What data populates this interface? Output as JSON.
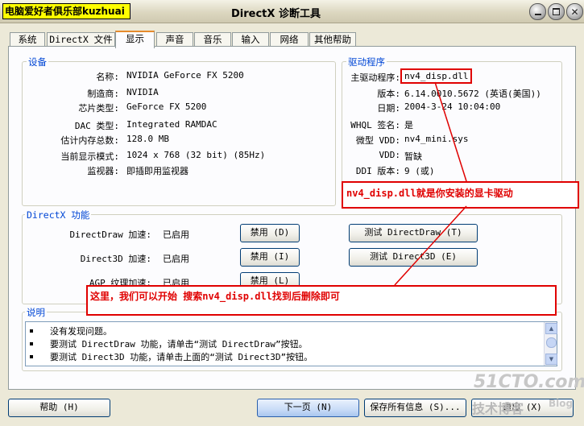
{
  "title_bar": {
    "brand": "电脑爱好者俱乐部kuzhuai",
    "title": "DirectX 诊断工具",
    "buttons": [
      "minimize-icon",
      "maximize-icon",
      "close-icon"
    ]
  },
  "tabs": [
    {
      "label": "系统"
    },
    {
      "label": "DirectX 文件"
    },
    {
      "label": "显示",
      "active": true
    },
    {
      "label": "声音"
    },
    {
      "label": "音乐"
    },
    {
      "label": "输入"
    },
    {
      "label": "网络"
    },
    {
      "label": "其他帮助"
    }
  ],
  "device": {
    "heading": "设备",
    "rows": [
      {
        "label": "名称:",
        "value": "NVIDIA GeForce FX 5200"
      },
      {
        "label": "制造商:",
        "value": "NVIDIA"
      },
      {
        "label": "芯片类型:",
        "value": "GeForce FX 5200"
      },
      {
        "label": "DAC 类型:",
        "value": "Integrated RAMDAC"
      },
      {
        "label": "估计内存总数:",
        "value": "128.0 MB"
      },
      {
        "label": "当前显示模式:",
        "value": "1024 x 768 (32 bit) (85Hz)"
      },
      {
        "label": "监视器:",
        "value": "即插即用监视器"
      }
    ]
  },
  "driver": {
    "heading": "驱动程序",
    "rows": [
      {
        "label": "主驱动程序:",
        "value": "nv4_disp.dll"
      },
      {
        "label": "版本:",
        "value": "6.14.0010.5672 (英语(美国))"
      },
      {
        "label": "日期:",
        "value": "2004-3-24 10:04:00"
      },
      {
        "label": "WHQL 签名:",
        "value": "是"
      },
      {
        "label": "微型 VDD:",
        "value": "nv4_mini.sys"
      },
      {
        "label": "VDD:",
        "value": "暂缺"
      },
      {
        "label": "DDI 版本:",
        "value": "9 (或)"
      }
    ],
    "annotation": "nv4_disp.dll就是你安装的显卡驱动"
  },
  "directx": {
    "heading": "DirectX 功能",
    "rows": [
      {
        "label": "DirectDraw 加速:",
        "status": "已启用",
        "disable": "禁用 (D)",
        "test": "测试 DirectDraw (T)"
      },
      {
        "label": "Direct3D 加速:",
        "status": "已启用",
        "disable": "禁用 (I)",
        "test": "测试 Direct3D (E)"
      },
      {
        "label": "AGP 纹理加速:",
        "status": "已启用",
        "disable": "禁用 (L)"
      }
    ],
    "annotation": "这里，我们可以开始 搜索nv4_disp.dll找到后删除即可"
  },
  "notes": {
    "heading": "说明",
    "lines": [
      "没有发现问题。",
      "要测试 DirectDraw 功能，请单击“测试 DirectDraw”按钮。",
      "要测试 Direct3D 功能，请单击上面的“测试 Direct3D”按钮。"
    ]
  },
  "bottom": {
    "help": "帮助 (H)",
    "next": "下一页 (N)",
    "save": "保存所有信息 (S)...",
    "exit": "退出 (X)"
  },
  "watermark": {
    "site": "51CTO.com",
    "blog": "技术博客",
    "blog_en": "Blog"
  },
  "colors": {
    "window_bg": "#ECE9D8",
    "panel_bg": "#FCFCFE",
    "group_label": "#0046D5",
    "annotation_red": "#E00000",
    "brand_bg": "#FFFF00"
  }
}
